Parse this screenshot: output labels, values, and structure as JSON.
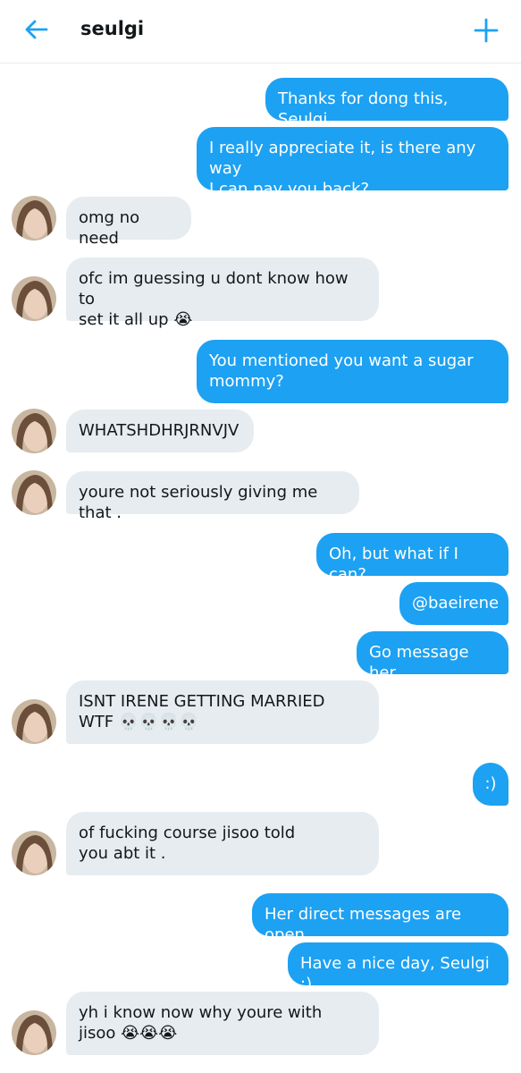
{
  "header": {
    "title": "seulgi",
    "back_icon": "arrow-left-icon",
    "new_icon": "plus-icon"
  },
  "colors": {
    "accent": "#1da1f2",
    "received_bubble": "#e6ecf0"
  },
  "messages": [
    {
      "side": "sent",
      "text": "Thanks for dong this, Seulgi."
    },
    {
      "side": "sent",
      "text": "I really appreciate it, is there any way\nI can pay you back?"
    },
    {
      "side": "received",
      "text": "omg no need"
    },
    {
      "side": "received",
      "text": "ofc im guessing u dont know how to\nset it all up 😭"
    },
    {
      "side": "sent",
      "text": "You mentioned you want a sugar\nmommy?"
    },
    {
      "side": "received",
      "text": "WHATSHDHRJRNVJV"
    },
    {
      "side": "received",
      "text": "youre not seriously giving me that ."
    },
    {
      "side": "sent",
      "text": "Oh, but what if I can?"
    },
    {
      "side": "sent",
      "text": "@baeirene"
    },
    {
      "side": "sent",
      "text": "Go message her."
    },
    {
      "side": "received",
      "text": "ISNT IRENE GETTING MARRIED\nWTF 💀💀💀💀"
    },
    {
      "side": "sent",
      "text": ":)"
    },
    {
      "side": "received",
      "text": "of fucking course jisoo told\nyou abt it ."
    },
    {
      "side": "sent",
      "text": "Her direct messages are open."
    },
    {
      "side": "sent",
      "text": "Have a nice day, Seulgi :)"
    },
    {
      "side": "received",
      "text": "yh i know now why youre with\njisoo 😭😭😭"
    }
  ]
}
